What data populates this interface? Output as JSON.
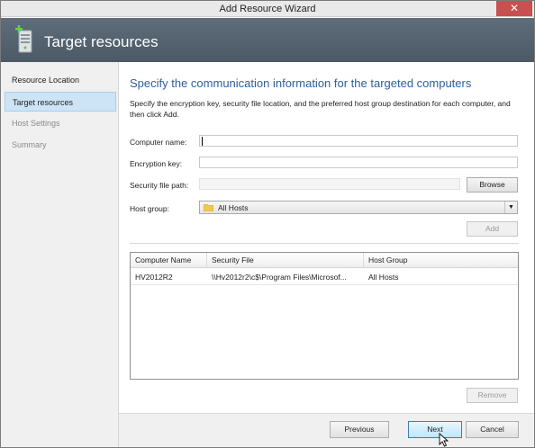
{
  "window": {
    "title": "Add Resource Wizard",
    "close_glyph": "✕"
  },
  "banner": {
    "title": "Target resources",
    "icon": "server-add-icon"
  },
  "nav": {
    "items": [
      {
        "label": "Resource Location",
        "state": "normal"
      },
      {
        "label": "Target resources",
        "state": "selected"
      },
      {
        "label": "Host Settings",
        "state": "disabled"
      },
      {
        "label": "Summary",
        "state": "disabled"
      }
    ]
  },
  "main": {
    "heading": "Specify the communication information for the targeted computers",
    "description": "Specify the encryption key, security file location, and the preferred host group destination for each computer, and then click Add.",
    "form": {
      "computer_name_label": "Computer name:",
      "computer_name_value": "",
      "encryption_key_label": "Encryption key:",
      "encryption_key_value": "",
      "security_file_label": "Security file path:",
      "security_file_value": "",
      "browse_label": "Browse",
      "host_group_label": "Host group:",
      "host_group_value": "All Hosts",
      "add_label": "Add"
    },
    "table": {
      "columns": [
        "Computer Name",
        "Security File",
        "Host Group"
      ],
      "rows": [
        [
          "HV2012R2",
          "\\\\Hv2012r2\\c$\\Program Files\\Microsof...",
          "All Hosts"
        ]
      ]
    },
    "remove_label": "Remove"
  },
  "footer": {
    "previous_label": "Previous",
    "next_label": "Next",
    "cancel_label": "Cancel"
  },
  "colors": {
    "heading": "#2f5f9a",
    "banner": "#5f6d7a",
    "nav_selected": "#cde4f7",
    "close_button": "#c75050"
  }
}
